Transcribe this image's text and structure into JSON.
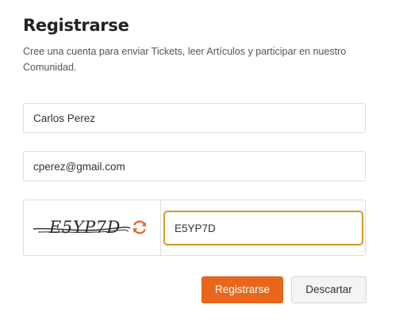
{
  "form": {
    "title": "Registrarse",
    "subtitle": "Cree una cuenta para enviar Tickets, leer Artículos y participar en nuestro Comunidad.",
    "name_value": "Carlos Perez",
    "email_value": "cperez@gmail.com",
    "captcha": {
      "image_text": "E5YP7D",
      "input_value": "E5YP7D",
      "refresh_icon": "refresh-icon",
      "refresh_color": "#e8671d"
    },
    "submit_label": "Registrarse",
    "cancel_label": "Descartar"
  },
  "colors": {
    "accent": "#e8671d",
    "focus_border": "#d49a22"
  }
}
